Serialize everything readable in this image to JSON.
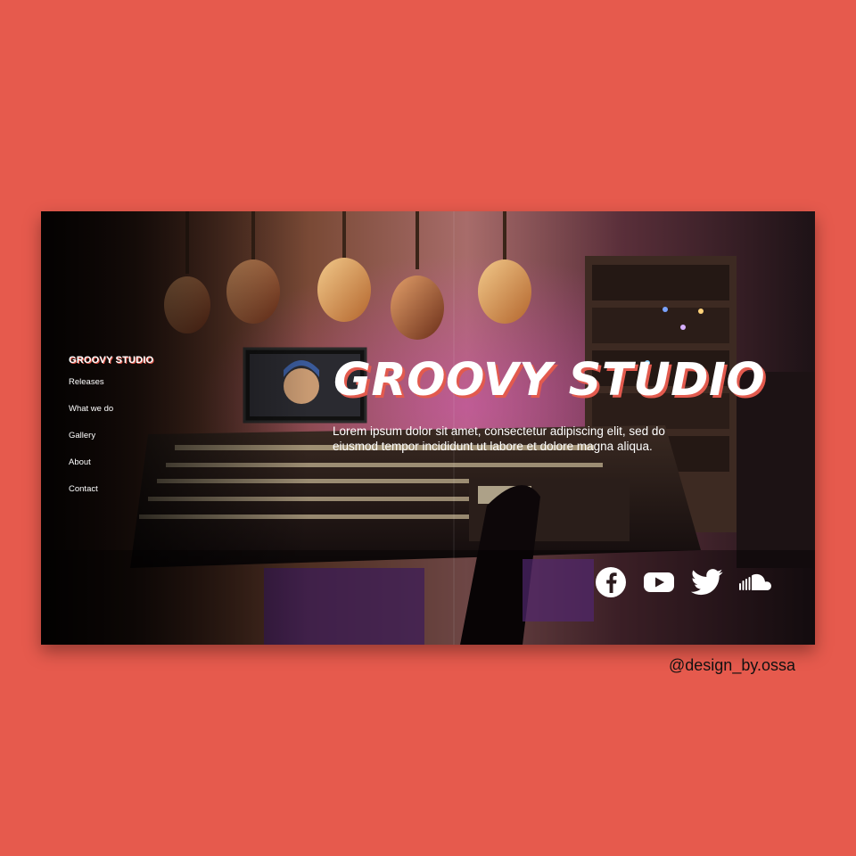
{
  "nav": {
    "brand": "GROOVY STUDIO",
    "items": [
      "Releases",
      "What we do",
      "Gallery",
      "About",
      "Contact"
    ]
  },
  "hero": {
    "title": "GROOVY STUDIO",
    "description": "Lorem ipsum dolor sit amet, consectetur adipiscing elit, sed do eiusmod tempor incididunt ut labore et dolore magna aliqua."
  },
  "social": {
    "icons": [
      "facebook-icon",
      "youtube-icon",
      "twitter-icon",
      "soundcloud-icon"
    ]
  },
  "credit": "@design_by.ossa",
  "colors": {
    "background": "#e65a4d",
    "accent": "#e25a4e",
    "text": "#ffffff"
  }
}
